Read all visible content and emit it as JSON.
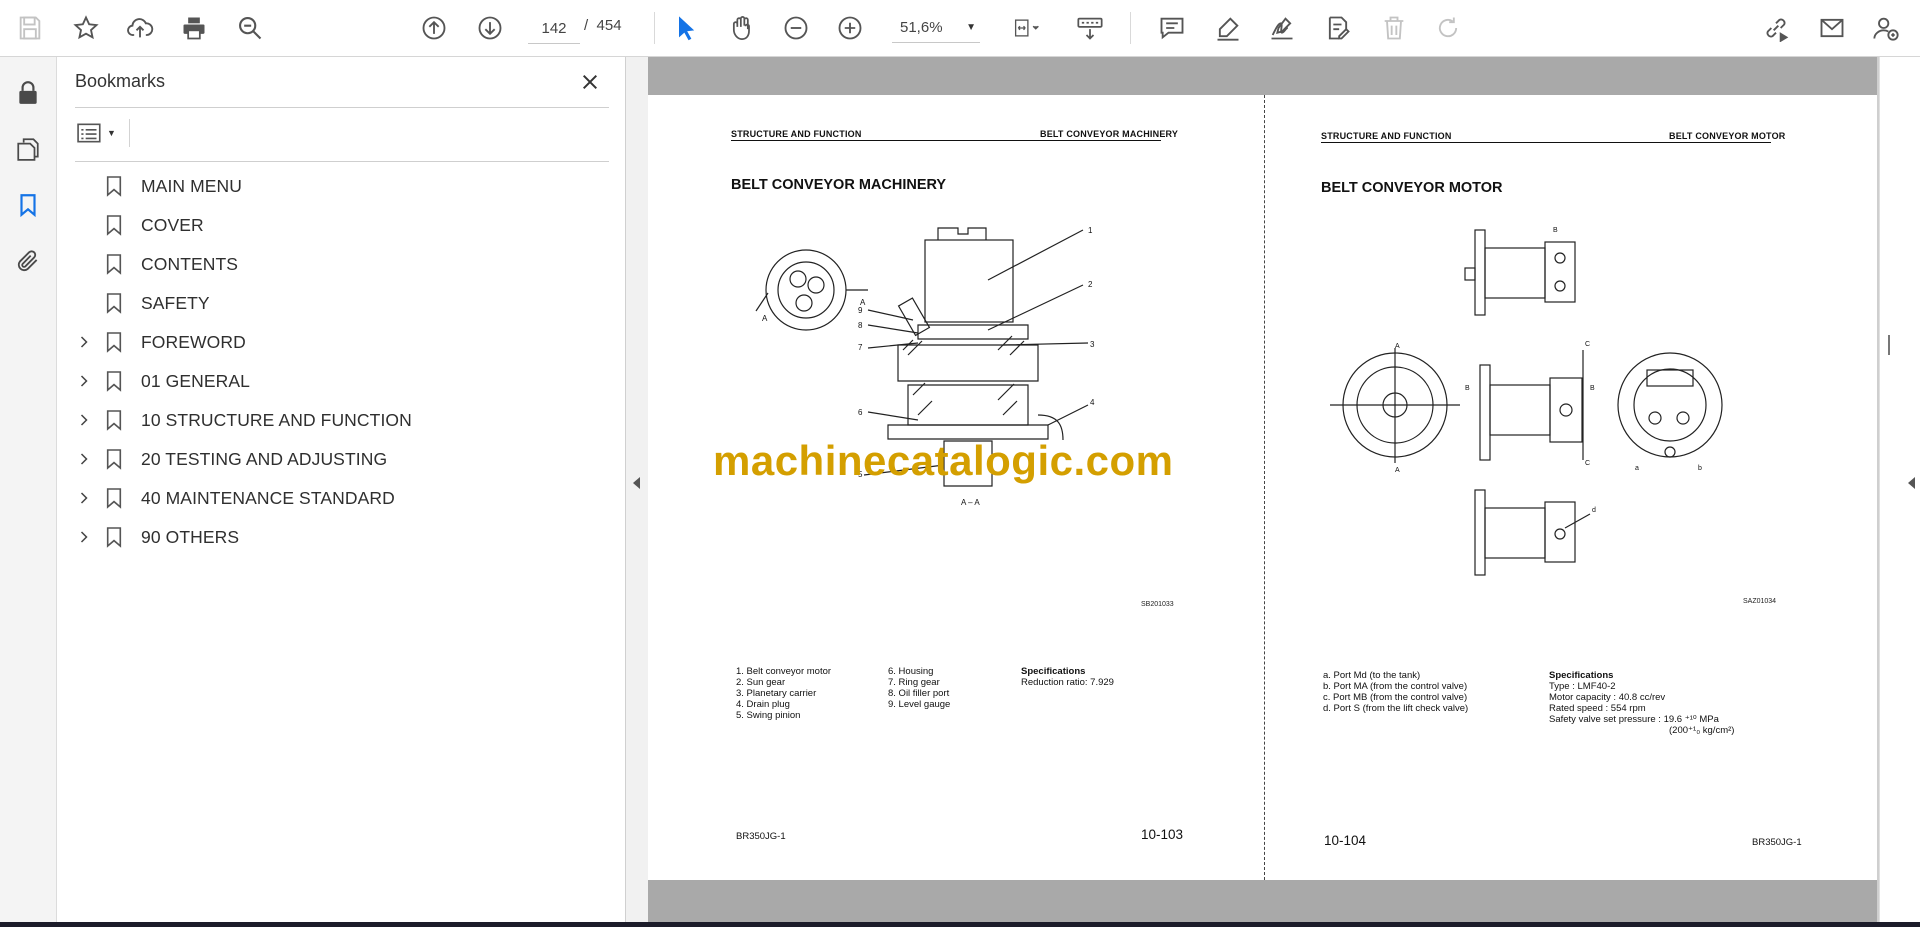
{
  "toolbar": {
    "current_page": "142",
    "page_separator": "/",
    "total_pages": "454",
    "zoom": "51,6%",
    "icons": [
      "save-icon",
      "star-icon",
      "upload-cloud-icon",
      "print-icon",
      "find-zoom-icon",
      "page-up-icon",
      "page-down-icon",
      "select-cursor-icon",
      "hand-icon",
      "zoom-out-icon",
      "zoom-in-icon",
      "page-fit-icon",
      "scroll-mode-icon",
      "comment-icon",
      "highlight-icon",
      "sign-icon",
      "edit-pdf-icon",
      "delete-icon",
      "redo-icon",
      "share-link-icon",
      "email-icon",
      "account-icon"
    ]
  },
  "rail": {
    "icons": [
      "lock-icon",
      "pages-icon",
      "bookmark-icon",
      "attachment-icon"
    ]
  },
  "bookmarks": {
    "title": "Bookmarks",
    "items": [
      {
        "label": "MAIN MENU",
        "expandable": false
      },
      {
        "label": "COVER",
        "expandable": false
      },
      {
        "label": "CONTENTS",
        "expandable": false
      },
      {
        "label": "SAFETY",
        "expandable": false
      },
      {
        "label": "FOREWORD",
        "expandable": true
      },
      {
        "label": "01 GENERAL",
        "expandable": true
      },
      {
        "label": "10 STRUCTURE AND FUNCTION",
        "expandable": true
      },
      {
        "label": "20 TESTING AND ADJUSTING",
        "expandable": true
      },
      {
        "label": "40 MAINTENANCE STANDARD",
        "expandable": true
      },
      {
        "label": "90 OTHERS",
        "expandable": true
      }
    ]
  },
  "left_page": {
    "header_left": "STRUCTURE AND FUNCTION",
    "header_right": "BELT CONVEYOR MACHINERY",
    "title": "BELT CONVEYOR MACHINERY",
    "figure_code": "SB201033",
    "section_label": "A – A",
    "legend_col1": [
      "1.  Belt  conveyor motor",
      "2.  Sun gear",
      "3.  Planetary carrier",
      "4.  Drain plug",
      "5.  Swing pinion"
    ],
    "legend_col2": [
      "6.  Housing",
      "7.  Ring gear",
      "8.  Oil filler port",
      "9.  Level gauge"
    ],
    "spec_title": "Specifications",
    "spec_text": "Reduction ratio: 7.929",
    "footer_model": "BR350JG-1",
    "footer_page": "10-103",
    "callouts": [
      "1",
      "2",
      "3",
      "4",
      "5",
      "6",
      "7",
      "8",
      "9",
      "A",
      "A"
    ]
  },
  "right_page": {
    "header_left": "STRUCTURE AND FUNCTION",
    "header_right": "BELT CONVEYOR MOTOR",
    "title": "BELT CONVEYOR MOTOR",
    "figure_code": "SAZ01034",
    "ports": [
      "a.  Port Md (to the tank)",
      "b.  Port MA (from the control valve)",
      "c.  Port MB (from the control valve)",
      "d.  Port S (from the lift check valve)"
    ],
    "spec_title": "Specifications",
    "specs": [
      "Type : LMF40-2",
      "Motor capacity : 40.8 cc/rev",
      "Rated speed : 554 rpm",
      "Safety valve set pressure : 19.6 ⁺¹⁰ MPa",
      "(200⁺¹₀ kg/cm²)"
    ],
    "footer_page": "10-104",
    "footer_model": "BR350JG-1"
  },
  "watermark": "machinecatalogic.com",
  "colors": {
    "accent_blue": "#1473e6",
    "watermark": "#d49f00",
    "gray_band": "#a9a9a9"
  }
}
